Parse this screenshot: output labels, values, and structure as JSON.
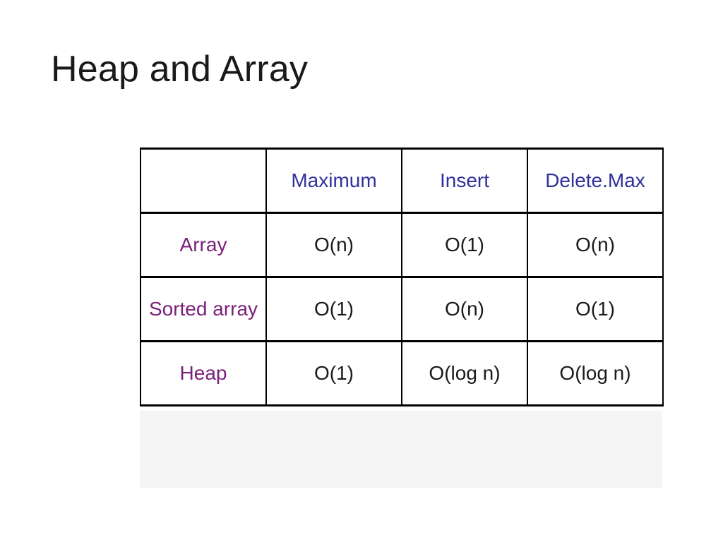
{
  "title": "Heap and Array",
  "chart_data": {
    "type": "table",
    "columns": [
      "",
      "Maximum",
      "Insert",
      "Delete.Max"
    ],
    "rows": [
      {
        "label": "Array",
        "values": [
          "O(n)",
          "O(1)",
          "O(n)"
        ]
      },
      {
        "label": "Sorted array",
        "values": [
          "O(1)",
          "O(n)",
          "O(1)"
        ]
      },
      {
        "label": "Heap",
        "values": [
          "O(1)",
          "O(log n)",
          "O(log n)"
        ]
      }
    ]
  },
  "colors": {
    "column_header": "#31319c",
    "row_header": "#7a1f7a",
    "border": "#000000",
    "background_strip": "#f5f5f5"
  }
}
